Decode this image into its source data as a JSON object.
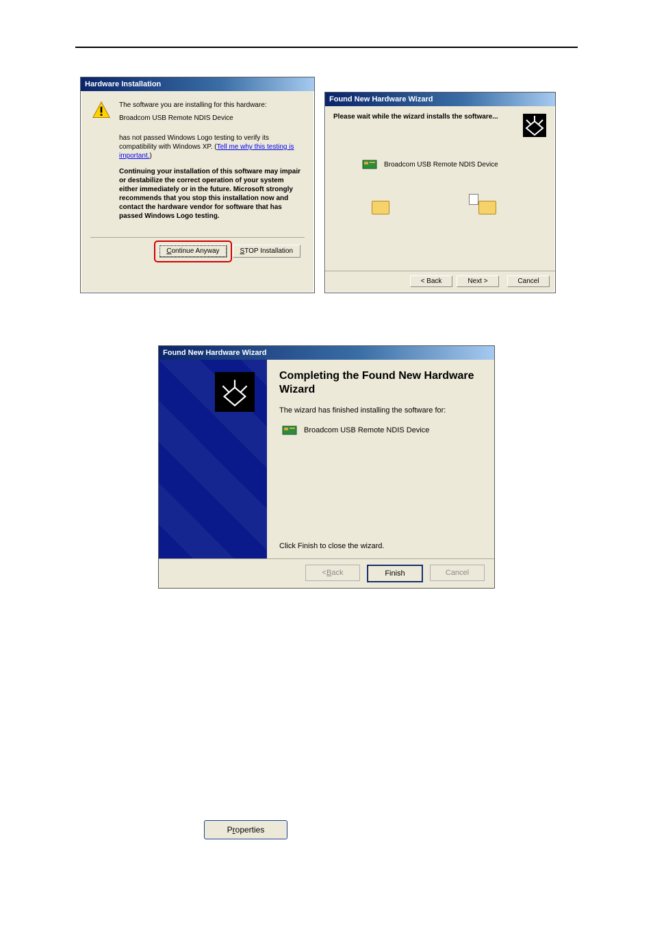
{
  "dlg1": {
    "title": "Hardware Installation",
    "intro": "The software you are installing for this hardware:",
    "device": "Broadcom USB Remote NDIS Device",
    "notPassed": "has not passed Windows Logo testing to verify its compatibility with Windows XP. (",
    "tellMe": "Tell me why this testing is important.",
    "notPassedEnd": ")",
    "warn": "Continuing your installation of this software may impair or destabilize the correct operation of your system either immediately or in the future. Microsoft strongly recommends that you stop this installation now and contact the hardware vendor for software that has passed Windows Logo testing.",
    "continue": "Continue Anyway",
    "stopPrefix": "S",
    "stopRest": "TOP Installation"
  },
  "dlg2": {
    "title": "Found New Hardware Wizard",
    "wait": "Please wait while the wizard installs the software...",
    "device": "Broadcom USB Remote NDIS Device",
    "back": "< Back",
    "next": "Next >",
    "cancel": "Cancel"
  },
  "dlg3": {
    "title": "Found New Hardware Wizard",
    "heading": "Completing the Found New Hardware Wizard",
    "finished": "The wizard has finished installing the software for:",
    "device": "Broadcom USB Remote NDIS Device",
    "close": "Click Finish to close the wizard.",
    "backU": "B",
    "backRest": "ack",
    "backPrefix": "< ",
    "finish": "Finish",
    "cancel": "Cancel"
  },
  "properties": {
    "pre": "P",
    "u": "r",
    "rest": "operties"
  }
}
